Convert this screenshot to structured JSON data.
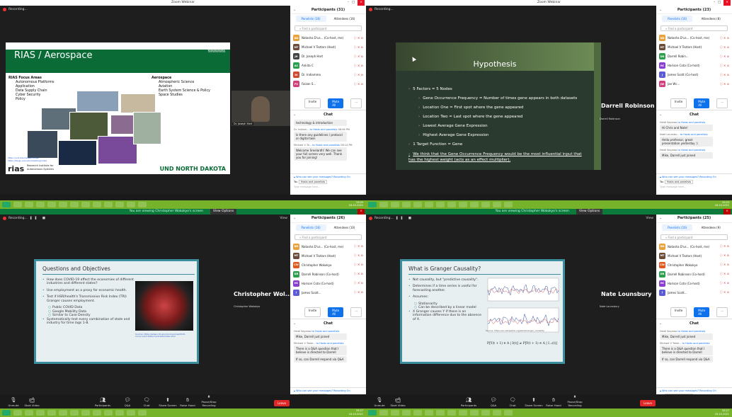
{
  "windows": [
    {
      "title": "Zoom Webinar",
      "recording": "Recording...",
      "presenter_label": "Dr. Joseph Hart",
      "slide": {
        "title": "RIAS / Aerospace",
        "left_heading": "RIAS Focus Areas",
        "left_items": [
          "Autonomous Platforms",
          "Application",
          "Data Supply Chain",
          "Cyber Security",
          "Policy"
        ],
        "right_heading": "Aerospace",
        "right_items": [
          "Atmospheric Science",
          "Aviation",
          "Earth System Science & Policy",
          "Space Studies"
        ],
        "link": "https://und.edu/research/rias\nhttps://blogs.und.edu/rias/blog/index",
        "logo": "rias",
        "logo_sub": "Research Institute for\nAutonomous Systems",
        "und_logo": "UND NORTH DAKOTA"
      },
      "panel": {
        "header": "Participants (31)",
        "tab_panelists": "Panelists (16)",
        "tab_attendees": "Attendees (16)",
        "find": "Find a participant",
        "participants": [
          {
            "initials": "ND",
            "color": "#e9a23b",
            "name": "Natasha D'us... (Co-host, me)"
          },
          {
            "initials": "MT",
            "color": "#6b4c3b",
            "name": "Michael V Teztars (Host)"
          },
          {
            "initials": "JH",
            "color": "#444444",
            "name": "Dr. Joseph Hart"
          },
          {
            "initials": "AC",
            "color": "#2e9e4f",
            "name": "Ankita C"
          },
          {
            "initials": "DI",
            "color": "#d04a2e",
            "name": "Dr. Indiamma"
          },
          {
            "initials": "FS",
            "color": "#d0407a",
            "name": "Faizan S..."
          }
        ],
        "invite": "Invite",
        "mute_all": "Mute All",
        "more": "...",
        "chat_header": "Chat",
        "messages": [
          {
            "meta": "",
            "to": "",
            "text": "technology & introduction"
          },
          {
            "meta": "Dr. Indiam...",
            "to": "to Hosts and panelists",
            "time": "08:08 PM",
            "text": "Is there any guidelines / protocol or digital twin"
          },
          {
            "meta": "Michael V Te...",
            "to": "to Hosts and panelists",
            "time": "08:14 PM",
            "text": "Welcome Sreelardh! We can see your full screen very well. Thank you for joining!"
          }
        ],
        "who_see": "Who can see your messages? Recording On",
        "to_label": "To:",
        "to_value": "Hosts and panelists",
        "type_ph": "Type message here..."
      },
      "clock": {
        "time": "19:05",
        "date": "18-10-2021"
      }
    },
    {
      "title": "Zoom Webinar",
      "recording": "Recording...",
      "presenter_label": "Darrell Robinson",
      "slide": {
        "title": "Hypothesis",
        "lines": [
          {
            "lv": 1,
            "text": "5 Factors = 5 Nodes"
          },
          {
            "lv": 2,
            "text": "Gene Occurrence Frequency = Number of times gene appears in both datasets"
          },
          {
            "lv": 2,
            "text": "Location One = First spot where the gene appeared"
          },
          {
            "lv": 2,
            "text": "Location Two = Last spot where the gene appeared"
          },
          {
            "lv": 2,
            "text": "Lowest Average Gene Expression"
          },
          {
            "lv": 2,
            "text": "Highest Average Gene Expression"
          },
          {
            "lv": 1,
            "text": "1 Target Function = Gene"
          }
        ],
        "underlined": "We think that the Gene Occurrence Frequency would be the most influential input that has the highest weight (acts as an effect multiplier)."
      },
      "panel": {
        "header": "Participants (23)",
        "tab_panelists": "Panelists (16)",
        "tab_attendees": "Attendees (8)",
        "find": "Find a participant",
        "participants": [
          {
            "initials": "ND",
            "color": "#e9a23b",
            "name": "Natasha D'us... (Co-host, me)"
          },
          {
            "initials": "MT",
            "color": "#6b4c3b",
            "name": "Michael V Teztars (Host)"
          },
          {
            "initials": "DR",
            "color": "#2e9e4f",
            "name": "Darrell Robin..."
          },
          {
            "initials": "HC",
            "color": "#8a3fd0",
            "name": "Harison Cota (Co-host)"
          },
          {
            "initials": "J",
            "color": "#5b5bd6",
            "name": "James Scott (Co-host)"
          },
          {
            "initials": "JW",
            "color": "#d0407a",
            "name": "Jae Wc..."
          }
        ],
        "invite": "Invite",
        "mute_all": "Mute All",
        "more": "...",
        "chat_header": "Chat",
        "messages": [
          {
            "meta": "Heidi Sayaroo",
            "to": "to Hosts and panelists",
            "time": "",
            "text": "Hi Chris and Nate!"
          },
          {
            "meta": "Nate Lounsbu...",
            "to": "to Hosts and panelists",
            "time": "",
            "text": "Hello professor, great presentation yesterday :)"
          },
          {
            "meta": "Heidi Sayaroo",
            "to": "to Hosts and panelists",
            "time": "",
            "text": "Mike, Darrell just joined"
          }
        ],
        "who_see": "Who can see your messages? Recording On",
        "to_label": "To:",
        "to_value": "Hosts and panelists",
        "type_ph": "Type message here..."
      },
      "clock": {
        "time": "20:03",
        "date": "18-10-2021"
      }
    },
    {
      "title": "",
      "banner": "You are viewing Christopher Wokokyo's screen",
      "view_options": "View Options",
      "recording": "Recording...",
      "view": "View",
      "presenter_label": "Christopher Wol...",
      "presenter_tag": "Christopher Wokokyo",
      "slide": {
        "title": "Questions and Objectives",
        "bullets": [
          {
            "sub": false,
            "text": "How does COVID-19 affect the economies of different industries and different states?"
          },
          {
            "sub": false,
            "text": "Use employment as a proxy for economic health."
          },
          {
            "sub": false,
            "text": "Test if HSR/health's Transmission Risk Index (TRI) Granger causes employment."
          },
          {
            "sub": true,
            "text": "Public COVID Data"
          },
          {
            "sub": true,
            "text": "Google Mobility Data"
          },
          {
            "sub": true,
            "text": "Similar to Case Density"
          },
          {
            "sub": false,
            "text": "Systematically test every combination of state and industry for time lags 1-8."
          }
        ],
        "caption": "Source: https://www.cdc.gov/coronavirus/2019-ncov/covid-data/covidview/index.html"
      },
      "panel": {
        "header": "Participants (26)",
        "tab_panelists": "Panelists (16)",
        "tab_attendees": "Attendees (10)",
        "find": "Find a participant",
        "participants": [
          {
            "initials": "ND",
            "color": "#e9a23b",
            "name": "Natasha D'us... (Co-host, me)"
          },
          {
            "initials": "MT",
            "color": "#6b4c3b",
            "name": "Michael V Teztars (Host)"
          },
          {
            "initials": "CW",
            "color": "#e05a1e",
            "name": "Christopher Wokokyo"
          },
          {
            "initials": "DR",
            "color": "#2e9e4f",
            "name": "Darrell Robinson (Co-host)"
          },
          {
            "initials": "HC",
            "color": "#8a3fd0",
            "name": "Harison Cota (Co-host)"
          },
          {
            "initials": "J",
            "color": "#5b5bd6",
            "name": "James Scott..."
          }
        ],
        "invite": "Invite",
        "mute_all": "Mute All",
        "more": "...",
        "chat_header": "Chat",
        "messages": [
          {
            "meta": "Heidi Sayaroo",
            "to": "to Hosts and panelists",
            "time": "",
            "text": "Mike, Darrell just joined"
          },
          {
            "meta": "Michael V Teste...",
            "to": "to Hosts and panelists",
            "time": "",
            "text": "There is a Q&A question that I believe is directed to Darrell"
          },
          {
            "meta": "",
            "to": "",
            "time": "",
            "text": "If so, can Darrell respond via Q&A"
          }
        ],
        "who_see": "Who can see your messages? Recording On",
        "to_label": "To:",
        "to_value": "Hosts and panelists",
        "type_ph": "Type message here..."
      },
      "toolbar": [
        "Unmute",
        "Start Video",
        "Participants",
        "Q&A",
        "Chat",
        "Share Screen",
        "Raise Hand",
        "Pause/Stop Recording"
      ],
      "leave": "Leave",
      "clock": {
        "time": "20:27",
        "date": "18-10-2021"
      }
    },
    {
      "title": "",
      "banner": "You are viewing Christopher Wokokyo's screen",
      "view_options": "View Options",
      "recording": "Recording...",
      "view": "View",
      "presenter_label": "Nate Lounsbury",
      "presenter_tag": "Nate Lounsbury",
      "slide": {
        "title": "What is Granger Causality?",
        "bullets": [
          {
            "sub": false,
            "text": "Not causality, but \"predictive causality\"."
          },
          {
            "sub": false,
            "text": "Determines if a time series is useful for forecasting another."
          },
          {
            "sub": false,
            "text": "Assumes:"
          },
          {
            "sub": true,
            "text": "Stationarity"
          },
          {
            "sub": true,
            "text": "Can be described by a linear model"
          },
          {
            "sub": false,
            "text": "X Granger causes Y if there is an information difference due to the absence of X."
          }
        ],
        "source": "Source: https://en.wikipedia.org/wiki/Granger_causality",
        "formula": "P[Y(t + 1) ∈ A | I(t)] ≠ P[Y(t + 1) ∈ A | I₋ₓ(t)]"
      },
      "panel": {
        "header": "Participants (25)",
        "tab_panelists": "Panelists (16)",
        "tab_attendees": "Attendees (9)",
        "find": "Find a participant",
        "participants": [
          {
            "initials": "ND",
            "color": "#e9a23b",
            "name": "Natasha D'us... (Co-host, me)"
          },
          {
            "initials": "MT",
            "color": "#6b4c3b",
            "name": "Michael V Teztars (Host)"
          },
          {
            "initials": "CW",
            "color": "#e05a1e",
            "name": "Christopher Wokokyo"
          },
          {
            "initials": "DR",
            "color": "#2e9e4f",
            "name": "Darrell Robinson (Co-host)"
          },
          {
            "initials": "HC",
            "color": "#8a3fd0",
            "name": "Harison Cota (Co-host)"
          },
          {
            "initials": "J",
            "color": "#5b5bd6",
            "name": "James Scott..."
          }
        ],
        "invite": "Invite",
        "mute_all": "Mute All",
        "more": "...",
        "chat_header": "Chat",
        "messages": [
          {
            "meta": "Heidi Sayaroo",
            "to": "to Hosts and panelists",
            "time": "",
            "text": "Mike, Darrell just joined"
          },
          {
            "meta": "Michael V Teste...",
            "to": "to Hosts and panelists",
            "time": "",
            "text": "There is a Q&A question that I believe is directed to Darrell"
          },
          {
            "meta": "",
            "to": "",
            "time": "",
            "text": "If so, can Darrell respond via Q&A"
          }
        ],
        "who_see": "Who can see your messages? Recording On",
        "to_label": "To:",
        "to_value": "Hosts and panelists",
        "type_ph": "Type message here..."
      },
      "toolbar": [
        "Unmute",
        "Start Video",
        "Participants",
        "Q&A",
        "Chat",
        "Share Screen",
        "Raise Hand",
        "Pause/Stop Recording"
      ],
      "leave": "Leave",
      "clock": {
        "time": "20:27",
        "date": "18-10-2021"
      }
    }
  ],
  "colors": {
    "zoom_blue": "#0e72ed",
    "taskbar": "#77b32a",
    "leave": "#e02828",
    "und_green": "#0a6b37",
    "slide_teal": "#3b8f9e"
  }
}
